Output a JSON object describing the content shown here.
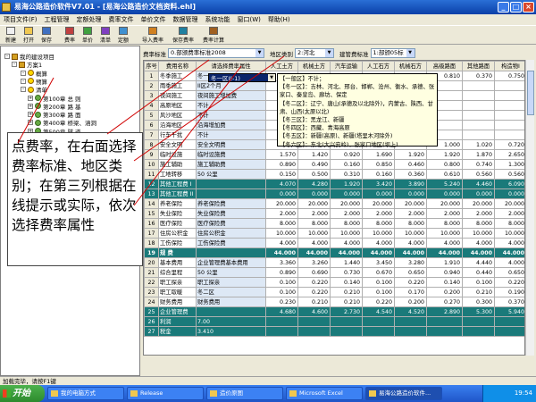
{
  "window": {
    "title": "易海公路造价软件V7.01 - [易海公路造价文档资料.ehl]"
  },
  "menu": [
    "项目文件(F)",
    "工程管理",
    "定额处理",
    "费率文件",
    "单价文件",
    "数据管理",
    "系统功能",
    "窗口(W)",
    "帮助(H)"
  ],
  "toolbar": [
    {
      "label": "新建",
      "icon": "new-file-icon"
    },
    {
      "label": "打开",
      "icon": "open-folder-icon"
    },
    {
      "label": "保存",
      "icon": "save-icon"
    },
    {
      "label": "费率",
      "icon": "rate-icon"
    },
    {
      "label": "单价",
      "icon": "price-icon"
    },
    {
      "label": "清单",
      "icon": "list-icon"
    },
    {
      "label": "定额",
      "icon": "quota-icon"
    },
    {
      "label": "导入费率",
      "icon": "import-rate-icon"
    },
    {
      "label": "保存费率",
      "icon": "save-rate-icon"
    },
    {
      "label": "费率计算",
      "icon": "calc-rate-icon"
    }
  ],
  "tree": [
    {
      "label": "我的建设项目",
      "indent": 0,
      "icon": "folder"
    },
    {
      "label": "方案1",
      "indent": 1,
      "icon": "folder"
    },
    {
      "label": "概算",
      "indent": 2,
      "icon": "gear"
    },
    {
      "label": "预算",
      "indent": 2,
      "icon": "gear"
    },
    {
      "label": "清单",
      "indent": 2,
      "icon": "gear"
    },
    {
      "label": "第100章  总    则",
      "indent": 3,
      "icon": "gear"
    },
    {
      "label": "第200章  路    基",
      "indent": 3,
      "icon": "gear"
    },
    {
      "label": "第300章  路    面",
      "indent": 3,
      "icon": "gear"
    },
    {
      "label": "第400章  桥梁、涵洞",
      "indent": 3,
      "icon": "gear"
    },
    {
      "label": "第500章  隧    道",
      "indent": 3,
      "icon": "gear"
    },
    {
      "label": "第600章  安全设施及预埋管线",
      "indent": 3,
      "icon": "gear"
    }
  ],
  "callout": {
    "text": "点费率，在右面选择费率标准、地区类别；在第三列根据在线提示或实际，依次选择费率属性"
  },
  "controls": {
    "rate_std_label": "费率标准",
    "rate_std_value": "0.部颁费率标准2008",
    "region_label": "地区类别",
    "region_value": "2:河北",
    "calc_label": "建管费标准",
    "calc_value": "1:部颁05标"
  },
  "table": {
    "headers": [
      "序号",
      "费用名称",
      "请选择费率属性",
      "人工土方",
      "机械土方",
      "汽车运输",
      "人工石方",
      "机械石方",
      "高级路面",
      "其他路面",
      "构造物I",
      "构"
    ],
    "rows": [
      {
        "n": "1",
        "name": "冬季施工",
        "attr": "冬一区I(-1)",
        "v": [
          "0.760",
          "1.170",
          "0.210",
          "0.150",
          "0.210",
          "0.810",
          "0.370",
          "0.750"
        ],
        "style": ""
      },
      {
        "n": "2",
        "name": "雨季施工",
        "attr": "II区2个月",
        "v": [
          "",
          "",
          "",
          "",
          "",
          "",
          "",
          ""
        ],
        "style": ""
      },
      {
        "n": "3",
        "name": "夜间施工",
        "attr": "夜间施工增加费",
        "v": [
          "",
          "",
          "",
          "",
          "",
          "",
          "",
          ""
        ],
        "style": ""
      },
      {
        "n": "4",
        "name": "高原地区",
        "attr": "不计",
        "v": [
          "",
          "",
          "",
          "",
          "",
          "",
          "",
          ""
        ],
        "style": ""
      },
      {
        "n": "5",
        "name": "风沙地区",
        "attr": "不计",
        "v": [
          "",
          "",
          "",
          "",
          "",
          "",
          "",
          ""
        ],
        "style": ""
      },
      {
        "n": "6",
        "name": "沿海地区",
        "attr": "沿海增加费",
        "v": [
          "",
          "",
          "",
          "",
          "",
          "",
          "",
          ""
        ],
        "style": ""
      },
      {
        "n": "7",
        "name": "行车干扰",
        "attr": "不计",
        "v": [
          "",
          "",
          "",
          "",
          "",
          "",
          "",
          ""
        ],
        "style": ""
      },
      {
        "n": "8",
        "name": "安全文明",
        "attr": "安全文明费",
        "v": [
          "0.590",
          "0.590",
          "0.210",
          "0.590",
          "0.590",
          "1.000",
          "1.020",
          "0.720"
        ],
        "style": ""
      },
      {
        "n": "9",
        "name": "临时设施",
        "attr": "临时设施费",
        "v": [
          "1.570",
          "1.420",
          "0.920",
          "1.690",
          "1.920",
          "1.920",
          "1.870",
          "2.650"
        ],
        "style": ""
      },
      {
        "n": "10",
        "name": "施工辅助",
        "attr": "施工辅助费",
        "v": [
          "0.890",
          "0.490",
          "0.160",
          "0.850",
          "0.460",
          "0.800",
          "0.740",
          "1.300"
        ],
        "style": ""
      },
      {
        "n": "11",
        "name": "工地转移",
        "attr": "50 公里",
        "v": [
          "0.150",
          "0.500",
          "0.310",
          "0.160",
          "0.360",
          "0.610",
          "0.560",
          "0.560"
        ],
        "style": ""
      },
      {
        "n": "12",
        "name": "其他工程费 I",
        "attr": "",
        "v": [
          "4.070",
          "4.280",
          "1.920",
          "3.420",
          "3.890",
          "5.240",
          "4.460",
          "6.090"
        ],
        "style": "teal"
      },
      {
        "n": "13",
        "name": "其他工程费 II",
        "attr": "",
        "v": [
          "0.000",
          "0.000",
          "0.000",
          "0.000",
          "0.000",
          "0.000",
          "0.000",
          "0.000"
        ],
        "style": "teal"
      },
      {
        "n": "14",
        "name": "养老保险",
        "attr": "养老保险费",
        "v": [
          "20.000",
          "20.000",
          "20.000",
          "20.000",
          "20.000",
          "20.000",
          "20.000",
          "20.000"
        ],
        "style": ""
      },
      {
        "n": "15",
        "name": "失业保险",
        "attr": "失业保险费",
        "v": [
          "2.000",
          "2.000",
          "2.000",
          "2.000",
          "2.000",
          "2.000",
          "2.000",
          "2.000"
        ],
        "style": ""
      },
      {
        "n": "16",
        "name": "医疗保险",
        "attr": "医疗保险费",
        "v": [
          "8.000",
          "8.000",
          "8.000",
          "8.000",
          "8.000",
          "8.000",
          "8.000",
          "8.000"
        ],
        "style": ""
      },
      {
        "n": "17",
        "name": "住房公积金",
        "attr": "住房公积金",
        "v": [
          "10.000",
          "10.000",
          "10.000",
          "10.000",
          "10.000",
          "10.000",
          "10.000",
          "10.000"
        ],
        "style": ""
      },
      {
        "n": "18",
        "name": "工伤保险",
        "attr": "工伤保险费",
        "v": [
          "4.000",
          "4.000",
          "4.000",
          "4.000",
          "4.000",
          "4.000",
          "4.000",
          "4.000"
        ],
        "style": ""
      },
      {
        "n": "19",
        "name": "规    费",
        "attr": "",
        "v": [
          "44.000",
          "44.000",
          "44.000",
          "44.000",
          "44.000",
          "44.000",
          "44.000",
          "44.000"
        ],
        "style": "teal bold"
      },
      {
        "n": "20",
        "name": "基本费用",
        "attr": "企业管理费基本费用",
        "v": [
          "3.360",
          "3.260",
          "1.440",
          "3.450",
          "3.280",
          "1.910",
          "4.440",
          "4.000"
        ],
        "style": ""
      },
      {
        "n": "21",
        "name": "综合里程",
        "attr": "50 公里",
        "v": [
          "0.890",
          "0.690",
          "0.730",
          "0.670",
          "0.650",
          "0.940",
          "0.440",
          "0.650"
        ],
        "style": ""
      },
      {
        "n": "22",
        "name": "职工探亲",
        "attr": "职工探亲",
        "v": [
          "0.100",
          "0.220",
          "0.140",
          "0.100",
          "0.220",
          "0.140",
          "0.100",
          "0.220"
        ],
        "style": ""
      },
      {
        "n": "23",
        "name": "职工取暖",
        "attr": "冬二区",
        "v": [
          "0.100",
          "0.220",
          "0.210",
          "0.100",
          "0.170",
          "0.200",
          "0.210",
          "0.190"
        ],
        "style": ""
      },
      {
        "n": "24",
        "name": "财务费用",
        "attr": "财务费用",
        "v": [
          "0.230",
          "0.210",
          "0.210",
          "0.220",
          "0.200",
          "0.270",
          "0.300",
          "0.370"
        ],
        "style": ""
      },
      {
        "n": "25",
        "name": "企业管理费",
        "attr": "",
        "v": [
          "4.680",
          "4.600",
          "2.730",
          "4.540",
          "4.520",
          "2.890",
          "5.300",
          "5.940"
        ],
        "style": "teal"
      },
      {
        "n": "26",
        "name": "利润",
        "attr": "7.00",
        "v": [
          "",
          "",
          "",
          "",
          "",
          "",
          "",
          ""
        ],
        "style": "teal"
      },
      {
        "n": "27",
        "name": "税金",
        "attr": "3.410",
        "v": [
          "",
          "",
          "",
          "",
          "",
          "",
          "",
          ""
        ],
        "style": "teal"
      }
    ]
  },
  "dropdown": {
    "value": "冬一区I(-1)"
  },
  "tooltip": {
    "lines": [
      "【一般区】不计；",
      "【冬一区】：吉林、河北、邢台、邯郸、沧州、衡水、承德、张家口、秦皇岛、廊坊、保定",
      "【冬二区】：辽宁、唐山(承德及以北除外)，内蒙古、陕西、甘肃、山西(太原以北)",
      "【冬三区】：黑龙江、新疆",
      "【冬四区】：西藏、青海高原",
      "【冬五区】：新疆(高原)、新疆(塔里木河除外)",
      "【冬六区】：东北(大兴安岭)、张家口地区(坝上)"
    ]
  },
  "status": {
    "text": "加载完毕，请按F1键"
  },
  "taskbar": {
    "start": "开始",
    "tasks": [
      "我的电脑方式",
      "Release",
      "造价原图",
      "Microsoft Excel",
      "易海公路造价软件..."
    ],
    "time": "19:54"
  },
  "colors": {
    "title_bar": "#0a3fa8",
    "total_row": "#1a7a7a",
    "attr_col": "#dde8f5",
    "callout_line": "#d00000"
  }
}
